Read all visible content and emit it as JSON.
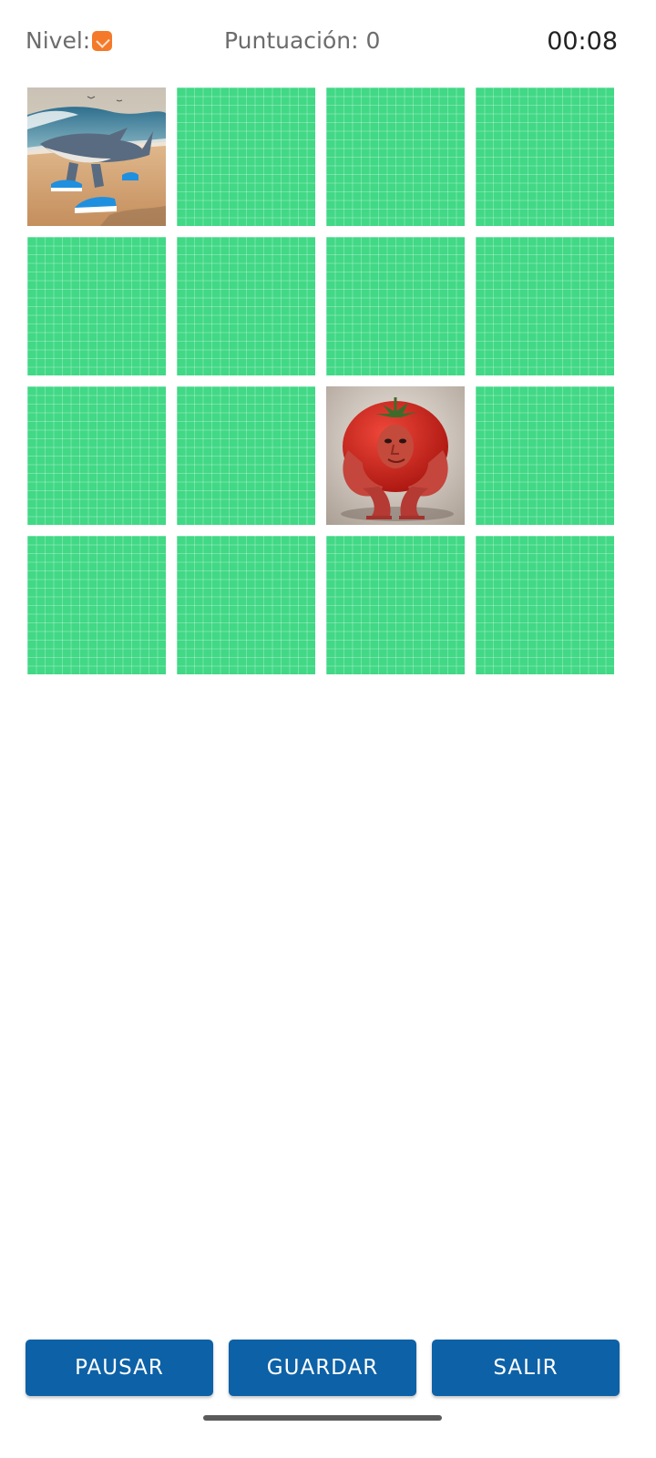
{
  "hud": {
    "level_label": "Nivel:",
    "score_label": "Puntuación: 0",
    "timer": "00:08"
  },
  "board": {
    "rows": 4,
    "columns": 4,
    "cards": [
      {
        "state": "face",
        "image": "shark-in-sneakers-on-beach"
      },
      {
        "state": "back"
      },
      {
        "state": "back"
      },
      {
        "state": "back"
      },
      {
        "state": "back"
      },
      {
        "state": "back"
      },
      {
        "state": "back"
      },
      {
        "state": "back"
      },
      {
        "state": "back"
      },
      {
        "state": "back"
      },
      {
        "state": "face",
        "image": "muscular-tomato-creature"
      },
      {
        "state": "back"
      },
      {
        "state": "back"
      },
      {
        "state": "back"
      },
      {
        "state": "back"
      },
      {
        "state": "back"
      }
    ]
  },
  "actions": {
    "pause_label": "PAUSAR",
    "save_label": "GUARDAR",
    "exit_label": "SALIR"
  },
  "colors": {
    "card_back": "#41d886",
    "button": "#0d61a7",
    "level_badge": "#f47a2a"
  }
}
